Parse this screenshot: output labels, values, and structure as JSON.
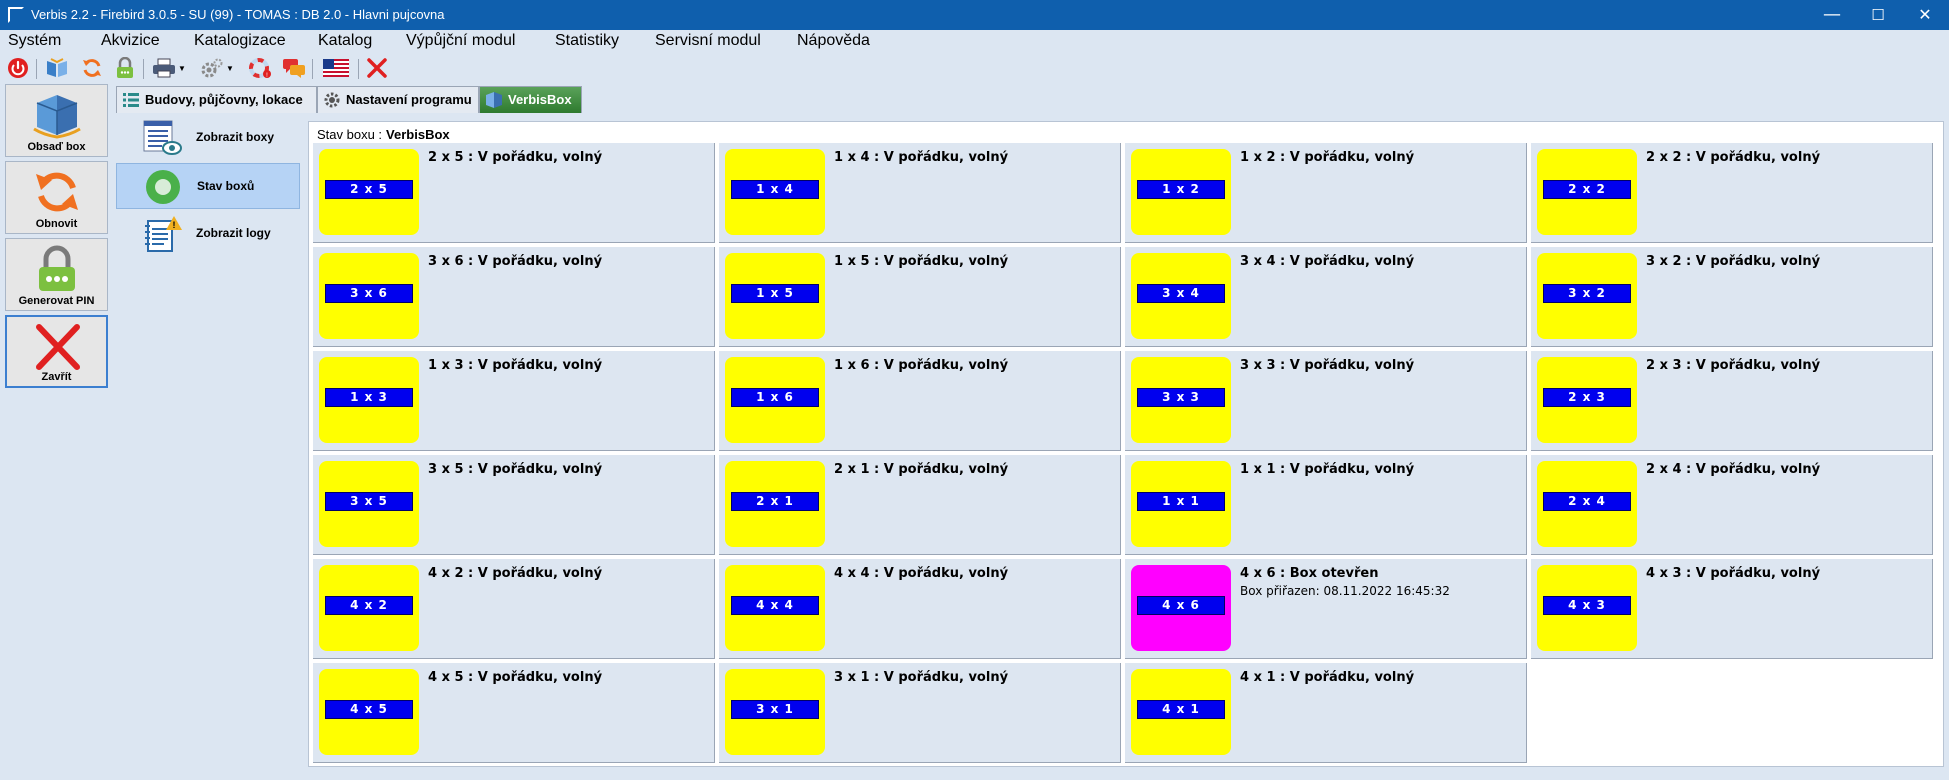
{
  "window": {
    "title": "Verbis 2.2 - Firebird 3.0.5 - SU (99) - TOMAS : DB 2.0 - Hlavni pujcovna",
    "minimize": "—",
    "maximize": "☐",
    "close": "✕"
  },
  "menu": [
    "Systém",
    "Akvizice",
    "Katalogizace",
    "Katalog",
    "Výpůjční modul",
    "Statistiky",
    "Servisní modul",
    "Nápověda"
  ],
  "toolbar": {
    "icons": [
      "power-icon",
      "book-icon",
      "refresh-icon",
      "lock-icon",
      "printer-icon",
      "settings-icon",
      "lifebuoy-icon",
      "messages-icon",
      "us-flag-icon",
      "close-icon"
    ]
  },
  "sidebar": {
    "buttons": [
      {
        "label": "Obsaď box"
      },
      {
        "label": "Obnovit"
      },
      {
        "label": "Generovat PIN"
      },
      {
        "label": "Zavřít"
      }
    ]
  },
  "tabs": [
    {
      "label": "Budovy, půjčovny, lokace"
    },
    {
      "label": "Nastavení programu"
    },
    {
      "label": "VerbisBox"
    }
  ],
  "subnav": [
    {
      "label": "Zobrazit boxy"
    },
    {
      "label": "Stav boxů"
    },
    {
      "label": "Zobrazit logy"
    }
  ],
  "status": {
    "heading": "Stav boxu :",
    "name": "VerbisBox"
  },
  "colors": {
    "free": "#ffff00",
    "open": "#ff00ff",
    "label_bg": "#0000ee",
    "titlebar": "#0f5fad"
  },
  "boxes": [
    {
      "label": "2 x 5",
      "status": "2 x 5 : V pořádku, volný",
      "detail": "",
      "state": "free"
    },
    {
      "label": "1 x 4",
      "status": "1 x 4 : V pořádku, volný",
      "detail": "",
      "state": "free"
    },
    {
      "label": "1 x 2",
      "status": "1 x 2 : V pořádku, volný",
      "detail": "",
      "state": "free"
    },
    {
      "label": "2 x 2",
      "status": "2 x 2 : V pořádku, volný",
      "detail": "",
      "state": "free"
    },
    {
      "label": "3 x 6",
      "status": "3 x 6 : V pořádku, volný",
      "detail": "",
      "state": "free"
    },
    {
      "label": "1 x 5",
      "status": "1 x 5 : V pořádku, volný",
      "detail": "",
      "state": "free"
    },
    {
      "label": "3 x 4",
      "status": "3 x 4 : V pořádku, volný",
      "detail": "",
      "state": "free"
    },
    {
      "label": "3 x 2",
      "status": "3 x 2 : V pořádku, volný",
      "detail": "",
      "state": "free"
    },
    {
      "label": "1 x 3",
      "status": "1 x 3 : V pořádku, volný",
      "detail": "",
      "state": "free"
    },
    {
      "label": "1 x 6",
      "status": "1 x 6 : V pořádku, volný",
      "detail": "",
      "state": "free"
    },
    {
      "label": "3 x 3",
      "status": "3 x 3 : V pořádku, volný",
      "detail": "",
      "state": "free"
    },
    {
      "label": "2 x 3",
      "status": "2 x 3 : V pořádku, volný",
      "detail": "",
      "state": "free"
    },
    {
      "label": "3 x 5",
      "status": "3 x 5 : V pořádku, volný",
      "detail": "",
      "state": "free"
    },
    {
      "label": "2 x 1",
      "status": "2 x 1 : V pořádku, volný",
      "detail": "",
      "state": "free"
    },
    {
      "label": "1 x 1",
      "status": "1 x 1 : V pořádku, volný",
      "detail": "",
      "state": "free"
    },
    {
      "label": "2 x 4",
      "status": "2 x 4 : V pořádku, volný",
      "detail": "",
      "state": "free"
    },
    {
      "label": "4 x 2",
      "status": "4 x 2 : V pořádku, volný",
      "detail": "",
      "state": "free"
    },
    {
      "label": "4 x 4",
      "status": "4 x 4 : V pořádku, volný",
      "detail": "",
      "state": "free"
    },
    {
      "label": "4 x 6",
      "status": "4 x 6 : Box otevřen",
      "detail": "Box přiřazen: 08.11.2022 16:45:32",
      "state": "open"
    },
    {
      "label": "4 x 3",
      "status": "4 x 3 : V pořádku, volný",
      "detail": "",
      "state": "free"
    },
    {
      "label": "4 x 5",
      "status": "4 x 5 : V pořádku, volný",
      "detail": "",
      "state": "free"
    },
    {
      "label": "3 x 1",
      "status": "3 x 1 : V pořádku, volný",
      "detail": "",
      "state": "free"
    },
    {
      "label": "4 x 1",
      "status": "4 x 1 : V pořádku, volný",
      "detail": "",
      "state": "free"
    }
  ]
}
